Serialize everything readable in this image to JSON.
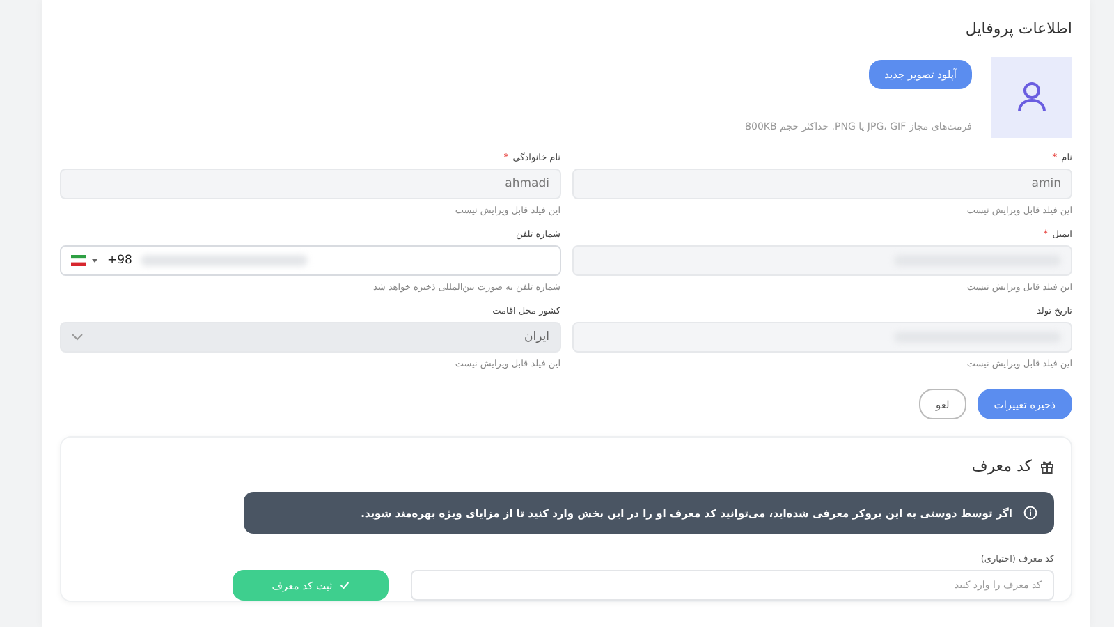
{
  "title": "اطلاعات پروفایل",
  "avatar": {
    "upload_button": "آپلود تصویر جدید",
    "hint": "فرمت‌های مجاز JPG، GIF یا PNG. حداکثر حجم 800KB"
  },
  "fields": [
    {
      "kind": "text",
      "label": "نام",
      "required_mark": "*",
      "value": "amin",
      "redacted": false,
      "disabled": true,
      "helper": "این فیلد قابل ویرایش نیست"
    },
    {
      "kind": "text",
      "label": "نام خانوادگی",
      "required_mark": "*",
      "value": "ahmadi",
      "redacted": false,
      "disabled": true,
      "helper": "این فیلد قابل ویرایش نیست"
    },
    {
      "kind": "text",
      "label": "ایمیل",
      "required_mark": "*",
      "redacted": true,
      "disabled": true,
      "helper": "این فیلد قابل ویرایش نیست"
    },
    {
      "kind": "phone",
      "label": "شماره تلفن",
      "prefix": "+98",
      "redacted": true,
      "disabled": false,
      "helper": "شماره تلفن به صورت بین‌المللی ذخیره خواهد شد"
    },
    {
      "kind": "text",
      "label": "تاریخ تولد",
      "redacted": true,
      "disabled": true,
      "helper": "این فیلد قابل ویرایش نیست"
    },
    {
      "kind": "select",
      "label": "کشور محل اقامت",
      "value": "ایران",
      "redacted": false,
      "disabled": true,
      "helper": "این فیلد قابل ویرایش نیست"
    }
  ],
  "actions": [
    {
      "label": "ذخیره تغییرات",
      "kind": "primary"
    },
    {
      "label": "لغو",
      "kind": "secondary"
    }
  ],
  "referral": {
    "title": "کد معرف",
    "notice": "اگر توسط دوستی به این بروکر معرفی شده‌اید، می‌توانید کد معرف او را در این بخش وارد کنید تا از مزایای ویژه بهره‌مند شوید.",
    "field_label": "کد معرف (اختیاری)",
    "placeholder": "کد معرف را وارد کنید",
    "submit_button": "ثبت کد معرف"
  }
}
